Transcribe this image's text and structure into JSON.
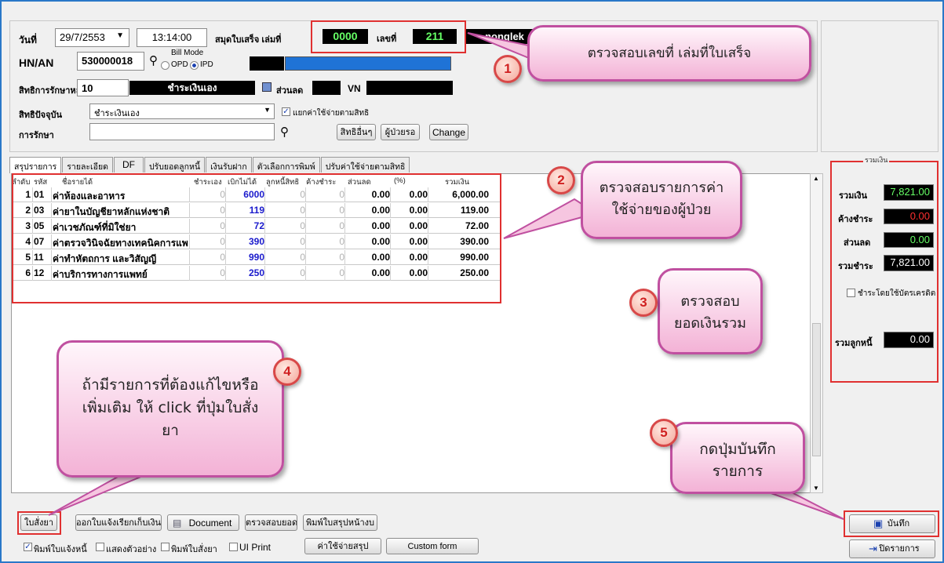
{
  "header": {
    "date_label": "วันที่",
    "date_value": "29/7/2553",
    "time_value": "13:14:00",
    "book_label": "สมุดใบเสร็จ เล่มที่",
    "book_no": "0000",
    "no_label": "เลขที่",
    "receipt_no": "211",
    "user": "nonglek",
    "hn_label": "HN/AN",
    "hn_value": "530000018",
    "bill_mode_label": "Bill Mode",
    "opd_label": "OPD",
    "ipd_label": "IPD",
    "main_right_label": "สิทธิการรักษาหลัก",
    "main_right_code": "10",
    "main_right_name": "ชำระเงินเอง",
    "discount_label": "ส่วนลด",
    "vn_label": "VN",
    "current_right_label": "สิทธิปัจจุบัน",
    "current_right_value": "ชำระเงินเอง",
    "split_label": "แยกค่าใช้จ่ายตามสิทธิ",
    "treatment_label": "การรักษา",
    "other_rights_btn": "สิทธิอื่นๆ",
    "patient_btn": "ผู้ป่วยรอ",
    "change_btn": "Change"
  },
  "tabs": [
    "สรุปรายการ",
    "รายละเอียด",
    "DF",
    "ปรับยอดลูกหนี้",
    "เงินรับฝาก",
    "ตัวเลือกการพิมพ์",
    "ปรับค่าใช้จ่ายตามสิทธิ"
  ],
  "table": {
    "columns": [
      "ลำดับ",
      "รหัส",
      "ชื่อรายได้",
      "ชำระเอง",
      "เบิกไม่ได้",
      "ลูกหนี้สิทธิ",
      "ค้างชำระ",
      "ส่วนลด",
      "(%)",
      "รวมเงิน"
    ],
    "rows": [
      {
        "no": "1",
        "code": "01",
        "name": "ค่าห้องและอาหาร",
        "self": "0",
        "nonclaim": "6000",
        "debtor": "0",
        "owed": "0",
        "disc": "0.00",
        "pct": "0.00",
        "total": "6,000.00"
      },
      {
        "no": "2",
        "code": "03",
        "name": "ค่ายาในบัญชียาหลักแห่งชาติ",
        "self": "0",
        "nonclaim": "119",
        "debtor": "0",
        "owed": "0",
        "disc": "0.00",
        "pct": "0.00",
        "total": "119.00"
      },
      {
        "no": "3",
        "code": "05",
        "name": "ค่าเวชภัณฑ์ที่มิใช่ยา",
        "self": "0",
        "nonclaim": "72",
        "debtor": "0",
        "owed": "0",
        "disc": "0.00",
        "pct": "0.00",
        "total": "72.00"
      },
      {
        "no": "4",
        "code": "07",
        "name": "ค่าตรวจวินิจฉัยทางเทคนิคการแพ",
        "self": "0",
        "nonclaim": "390",
        "debtor": "0",
        "owed": "0",
        "disc": "0.00",
        "pct": "0.00",
        "total": "390.00"
      },
      {
        "no": "5",
        "code": "11",
        "name": "ค่าทำหัตถการ และวิสัญญี",
        "self": "0",
        "nonclaim": "990",
        "debtor": "0",
        "owed": "0",
        "disc": "0.00",
        "pct": "0.00",
        "total": "990.00"
      },
      {
        "no": "6",
        "code": "12",
        "name": "ค่าบริการทางการแพทย์",
        "self": "0",
        "nonclaim": "250",
        "debtor": "0",
        "owed": "0",
        "disc": "0.00",
        "pct": "0.00",
        "total": "250.00"
      }
    ]
  },
  "summary": {
    "group_label": "รวมเงิน",
    "total_label": "รวมเงิน",
    "total_value": "7,821.00",
    "owed_label": "ค้างชำระ",
    "owed_value": "0.00",
    "discount_label": "ส่วนลด",
    "discount_value": "0.00",
    "paid_label": "รวมชำระ",
    "paid_value": "7,821.00",
    "credit_card_label": "ชำระโดยใช้บัตรเครดิต",
    "debtor_label": "รวมลูกหนี้",
    "debtor_value": "0.00",
    "colors": {
      "total": "#66ff66",
      "owed": "#ff3030",
      "discount": "#66ff66",
      "paid": "#ffffff",
      "debtor": "#ffffff"
    }
  },
  "bottom": {
    "prescription_btn": "ใบสั่งยา",
    "invoice_btn": "ออกใบแจ้งเรียกเก็บเงิน",
    "document_btn": "Document",
    "check_total_btn": "ตรวจสอบยอด",
    "print_summary_btn": "พิมพ์ใบสรุปหน้างบ",
    "chk_print_invoice": "พิมพ์ใบแจ้งหนี้",
    "chk_preview": "แสดงตัวอย่าง",
    "chk_print_rx": "พิมพ์ใบสั่งยา",
    "chk_ui_print": "UI Print",
    "summary_cost_btn": "ค่าใช้จ่ายสรุป",
    "custom_form_btn": "Custom form",
    "save_btn": "บันทึก",
    "close_btn": "ปิดรายการ"
  },
  "callouts": [
    {
      "num": "1",
      "text": "ตรวจสอบเลขที่ เล่มที่ใบเสร็จ"
    },
    {
      "num": "2",
      "text": "ตรวจสอบรายการค่าใช้จ่ายของผู้ป่วย"
    },
    {
      "num": "3",
      "text": "ตรวจสอบยอดเงินรวม"
    },
    {
      "num": "4",
      "text": "ถ้ามีรายการที่ต้องแก้ไขหรือเพิ่มเติม ให้ click ที่ปุ่มใบสั่งยา"
    },
    {
      "num": "5",
      "text": "กดปุ่มบันทึกรายการ"
    }
  ]
}
